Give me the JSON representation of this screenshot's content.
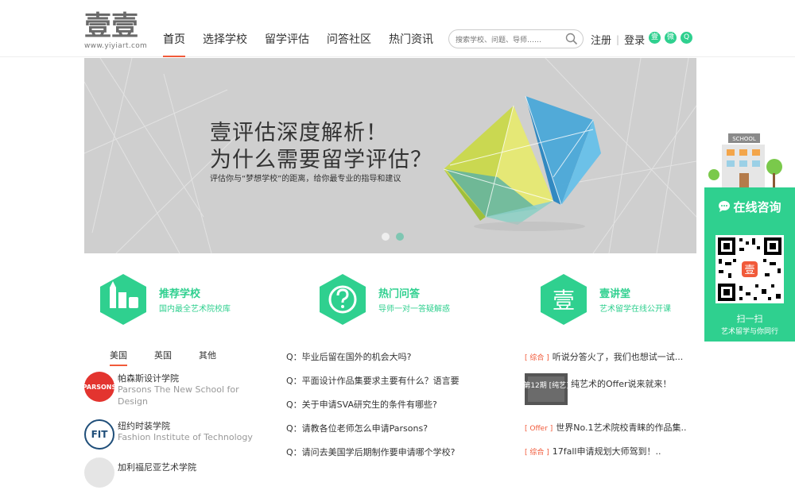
{
  "logo": {
    "main": "壹壹",
    "sub": "www.yiyiart.com"
  },
  "nav": [
    {
      "label": "首页",
      "active": true
    },
    {
      "label": "选择学校"
    },
    {
      "label": "留学评估"
    },
    {
      "label": "问答社区"
    },
    {
      "label": "热门资讯"
    }
  ],
  "search": {
    "placeholder": "搜索学校、问题、导师……"
  },
  "auth": {
    "register": "注册",
    "separator": "|",
    "login": "登录"
  },
  "social": [
    "壹",
    "微",
    "Q"
  ],
  "banner": {
    "title1": "壹评估深度解析！",
    "title2": "为什么需要留学评估？",
    "subtitle": "评估你与“梦想学校”的距离，给你最专业的指导和建议",
    "school_sign": "SCHOOL"
  },
  "consult": {
    "head": "在线咨询",
    "scan": "扫一扫",
    "slogan": "艺术留学与你同行",
    "qr_center": "壹"
  },
  "features": [
    {
      "title": "推荐学校",
      "sub": "国内最全艺术院校库",
      "icon": "pencil-tube-icon"
    },
    {
      "title": "热门问答",
      "sub": "导师一对一答疑解惑",
      "icon": "question-icon"
    },
    {
      "title": "壹讲堂",
      "sub": "艺术留学在线公开课",
      "icon": "yi-icon",
      "icon_text": "壹"
    }
  ],
  "school_tabs": [
    {
      "label": "美国",
      "active": true
    },
    {
      "label": "英国"
    },
    {
      "label": "其他"
    }
  ],
  "schools": [
    {
      "badge": "PARSONS",
      "cn": "帕森斯设计学院",
      "en": "Parsons The New School for Design",
      "color": "#e3342f"
    },
    {
      "badge": "FIT",
      "cn": "纽约时装学院",
      "en": "Fashion Institute of Technology",
      "color": "#1f4e79"
    },
    {
      "badge": "",
      "cn": "加利福尼亚艺术学院",
      "en": "",
      "color": "#ddd"
    }
  ],
  "questions": [
    "Q：毕业后留在国外的机会大吗?",
    "Q：平面设计作品集要求主要有什么？语言要",
    "Q：关于申请SVA研究生的条件有哪些?",
    "Q：请教各位老师怎么申请Parsons?",
    "Q：请问去美国学后期制作要申请哪个学校?"
  ],
  "news": [
    {
      "tag": "[ 综合 ]",
      "text": "听说分答火了，我们也想试一试..."
    },
    {
      "tag": "[ Offer ]",
      "text": "世界No.1艺术院校青睐的作品集.."
    },
    {
      "tag": "[ 综合 ]",
      "text": "17fall申请规划大师驾到！.."
    }
  ],
  "news_featured": {
    "image_text": "第12期 [纯艺]",
    "title": "纯艺术的Offer说来就来！"
  }
}
